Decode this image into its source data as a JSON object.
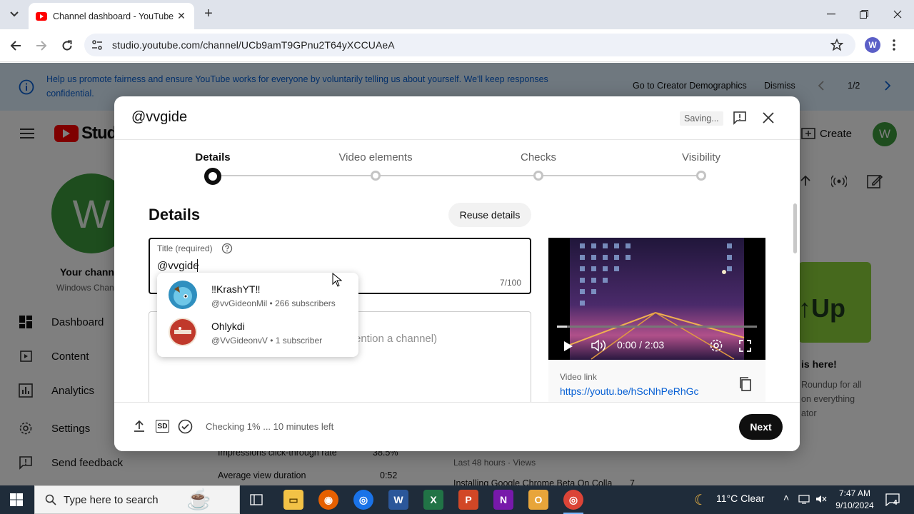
{
  "browser": {
    "tab_title": "Channel dashboard - YouTube",
    "url": "studio.youtube.com/channel/UCb9amT9GPnu2T64yXCCUAeA",
    "profile_initial": "W"
  },
  "banner": {
    "text": "Help us promote fairness and ensure YouTube works for everyone by voluntarily telling us about yourself. We'll keep responses confidential.",
    "go_button": "Go to Creator Demographics",
    "dismiss_button": "Dismiss",
    "pager": "1/2"
  },
  "header": {
    "logo_text": "Studi",
    "create_label": "Create",
    "avatar_initial": "W"
  },
  "sidebar": {
    "avatar_initial": "W",
    "channel_title": "Your chann",
    "channel_sub": "Windows Chan",
    "items": [
      {
        "label": "Dashboard",
        "icon": "dashboard-icon"
      },
      {
        "label": "Content",
        "icon": "content-icon"
      },
      {
        "label": "Analytics",
        "icon": "analytics-icon"
      },
      {
        "label": "Settings",
        "icon": "gear-icon"
      },
      {
        "label": "Send feedback",
        "icon": "feedback-icon"
      }
    ]
  },
  "background_page": {
    "news_title": "is here!",
    "news_lines": [
      "Roundup for all",
      "on everything",
      "ator"
    ],
    "stats": [
      {
        "label": "Impressions click-through rate",
        "value": "38.5%"
      },
      {
        "label": "Average view duration",
        "value": "0:52"
      }
    ],
    "recent_meta": "Last 48 hours · Views",
    "recent_item": "Installing Google Chrome Beta On Colla",
    "recent_value": "7"
  },
  "modal": {
    "title": "@vvgide",
    "saving_label": "Saving...",
    "steps": [
      {
        "label": "Details",
        "active": true
      },
      {
        "label": "Video elements",
        "active": false
      },
      {
        "label": "Checks",
        "active": false
      },
      {
        "label": "Visibility",
        "active": false
      }
    ],
    "section_title": "Details",
    "reuse_button": "Reuse details",
    "title_field": {
      "label": "Title (required)",
      "value": "@vvgide",
      "count": "7/100"
    },
    "description_placeholder_fragment": "ention a channel)",
    "video": {
      "time": "0:00 / 2:03",
      "link_label": "Video link",
      "link": "https://youtu.be/hScNhPeRhGc"
    },
    "footer": {
      "status": "Checking 1% ... 10 minutes left",
      "sd_badge": "SD",
      "next_button": "Next"
    }
  },
  "mention_suggestions": [
    {
      "name": "‼KrashYT‼",
      "sub": "@vvGideonMil • 266 subscribers",
      "avatar_color": "#3aa0c8"
    },
    {
      "name": "Ohlykdi",
      "sub": "@VvGideonvV • 1 subscriber",
      "avatar_color": "#c0392b"
    }
  ],
  "taskbar": {
    "search_placeholder": "Type here to search",
    "weather": "11°C  Clear",
    "time": "7:47 AM",
    "date": "9/10/2024",
    "notification_count": "4"
  }
}
